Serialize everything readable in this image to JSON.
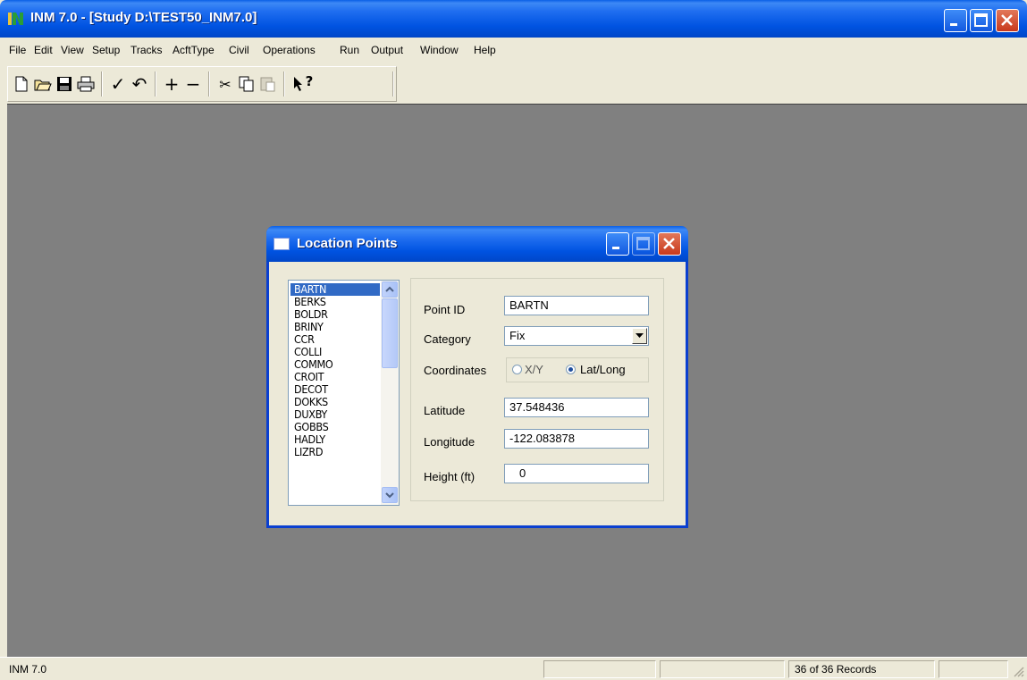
{
  "app": {
    "title": "INM 7.0 - [Study D:\\TEST50_INM7.0]"
  },
  "menu": [
    {
      "label": "File"
    },
    {
      "label": "Edit"
    },
    {
      "label": "View"
    },
    {
      "label": "Setup"
    },
    {
      "label": "Tracks"
    },
    {
      "label": "AcftType"
    },
    {
      "label": "Civil"
    },
    {
      "label": "Operations"
    },
    {
      "label": "Run"
    },
    {
      "label": "Output"
    },
    {
      "label": "Window"
    },
    {
      "label": "Help"
    }
  ],
  "toolbar": {
    "new_icon": "new-document-icon",
    "open_icon": "open-folder-icon",
    "save_icon": "save-disk-icon",
    "print_icon": "print-icon",
    "check_glyph": "✓",
    "undo_glyph": "↶",
    "plus_glyph": "+",
    "minus_glyph": "−",
    "cut_glyph": "✂",
    "help_glyph": "?"
  },
  "dialog": {
    "title": "Location Points",
    "list_items": [
      "BARTN",
      "BERKS",
      "BOLDR",
      "BRINY",
      "CCR",
      "COLLI",
      "COMMO",
      "CROIT",
      "DECOT",
      "DOKKS",
      "DUXBY",
      "GOBBS",
      "HADLY",
      "LIZRD"
    ],
    "selected_item": "BARTN",
    "point_id_label": "Point ID",
    "point_id_value": "BARTN",
    "category_label": "Category",
    "category_value": "Fix",
    "coordinates_label": "Coordinates",
    "coord_option_xy": "X/Y",
    "coord_option_latlong": "Lat/Long",
    "coord_selected": "Lat/Long",
    "latitude_label": "Latitude",
    "latitude_value": "37.548436",
    "longitude_label": "Longitude",
    "longitude_value": "-122.083878",
    "height_label": "Height (ft)",
    "height_value": "0"
  },
  "status": {
    "main": "INM 7.0",
    "records": "36 of 36  Records"
  },
  "colors": {
    "titlebar": "#0053e1",
    "workspace": "#808080",
    "selection": "#316ac5",
    "close_button": "#c8391c"
  }
}
